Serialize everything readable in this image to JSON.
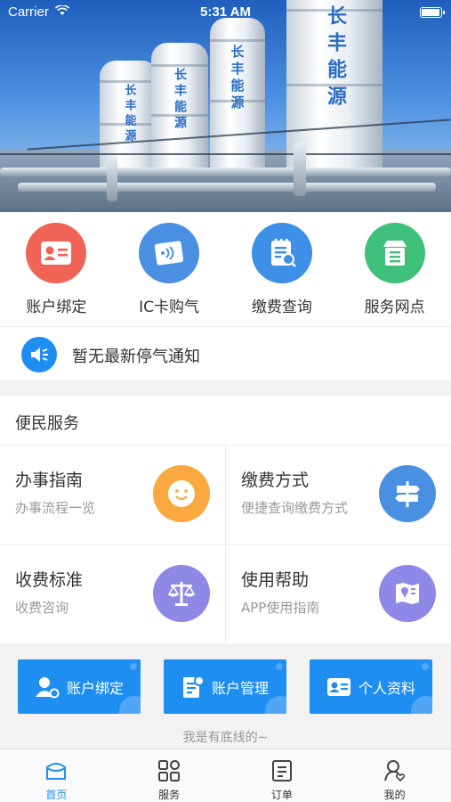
{
  "status_bar": {
    "carrier": "Carrier",
    "time": "5:31 AM",
    "battery_level": 1.0
  },
  "hero": {
    "tank_labels": [
      "长丰能源",
      "长丰能源",
      "长丰能源",
      "长丰能源"
    ]
  },
  "quick_actions": [
    {
      "label": "账户绑定",
      "icon": "id-card-icon",
      "color": "#ef6457"
    },
    {
      "label": "IC卡购气",
      "icon": "ic-card-icon",
      "color": "#4a90e2"
    },
    {
      "label": "缴费查询",
      "icon": "bill-search-icon",
      "color": "#3d8fe8"
    },
    {
      "label": "服务网点",
      "icon": "shop-icon",
      "color": "#3ec07a"
    }
  ],
  "notice": {
    "text": "暂无最新停气通知",
    "icon": "speaker-icon"
  },
  "services": {
    "title": "便民服务",
    "items": [
      {
        "title": "办事指南",
        "subtitle": "办事流程一览",
        "icon": "smiley-icon",
        "color": "#f9a940"
      },
      {
        "title": "缴费方式",
        "subtitle": "便捷查询缴费方式",
        "icon": "signpost-icon",
        "color": "#4a90e2"
      },
      {
        "title": "收费标准",
        "subtitle": "收费咨询",
        "icon": "scale-icon",
        "color": "#8f88e6"
      },
      {
        "title": "使用帮助",
        "subtitle": "APP使用指南",
        "icon": "map-book-icon",
        "color": "#8f88e6"
      }
    ]
  },
  "shortcuts": {
    "buttons": [
      {
        "label": "账户绑定",
        "icon": "user-bind-icon"
      },
      {
        "label": "账户管理",
        "icon": "account-manage-icon"
      },
      {
        "label": "个人资料",
        "icon": "profile-card-icon"
      }
    ],
    "footer_text": "我是有底线的~",
    "accent": "#1f8ef1"
  },
  "tabbar": {
    "tabs": [
      {
        "label": "首页",
        "icon": "home-icon",
        "active": true
      },
      {
        "label": "服务",
        "icon": "grid-icon",
        "active": false
      },
      {
        "label": "订单",
        "icon": "order-icon",
        "active": false
      },
      {
        "label": "我的",
        "icon": "profile-icon",
        "active": false
      }
    ]
  }
}
